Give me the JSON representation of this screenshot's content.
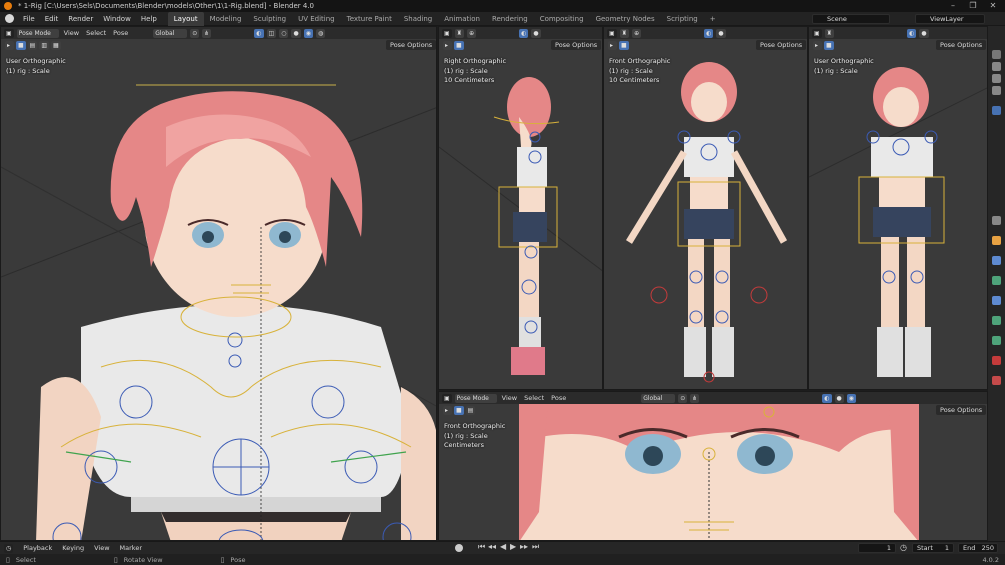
{
  "window": {
    "title": "* 1-Rig [C:\\Users\\Sels\\Documents\\Blender\\models\\Other\\1\\1-Rig.blend] - Blender 4.0",
    "controls": [
      "–",
      "❐",
      "✕"
    ]
  },
  "menubar": {
    "menus": [
      "File",
      "Edit",
      "Render",
      "Window",
      "Help"
    ],
    "workspaces": [
      "Layout",
      "Modeling",
      "Sculpting",
      "UV Editing",
      "Texture Paint",
      "Shading",
      "Animation",
      "Rendering",
      "Compositing",
      "Geometry Nodes",
      "Scripting"
    ],
    "active_workspace": "Layout",
    "add_tab": "+",
    "scene": "Scene",
    "view_layer": "ViewLayer"
  },
  "viewports": {
    "main": {
      "mode": "Pose Mode",
      "menus": [
        "View",
        "Select",
        "Pose"
      ],
      "orientation": "Global",
      "pose_options": "Pose Options",
      "info": [
        "User Orthographic",
        "(1) rig : Scale"
      ]
    },
    "right": {
      "pose_options": "Pose Options",
      "info": [
        "Right Orthographic",
        "(1) rig : Scale",
        "10 Centimeters"
      ]
    },
    "front": {
      "pose_options": "Pose Options",
      "info": [
        "Front Orthographic",
        "(1) rig : Scale",
        "10 Centimeters"
      ]
    },
    "user": {
      "pose_options": "Pose Options",
      "info": [
        "User Orthographic",
        "(1) rig : Scale"
      ]
    },
    "face": {
      "mode": "Pose Mode",
      "menus": [
        "View",
        "Select",
        "Pose"
      ],
      "orientation": "Global",
      "pose_options": "Pose Options",
      "info": [
        "Front Orthographic",
        "(1) rig : Scale",
        "Centimeters"
      ]
    }
  },
  "timeline": {
    "menus": [
      "Playback",
      "Keying",
      "View",
      "Marker"
    ],
    "current_frame": "1",
    "start_label": "Start",
    "start": "1",
    "end_label": "End",
    "end": "250"
  },
  "statusbar": {
    "items": [
      "Select",
      "Rotate View",
      "Pose"
    ],
    "version": "4.0.2"
  },
  "colors": {
    "accent": "#4772b3",
    "bone_blue": "#3b5bb5",
    "bone_yellow": "#d8b23a",
    "bone_green": "#3fa34d",
    "hair": "#e58a8a",
    "skin": "#f3d7c4"
  }
}
